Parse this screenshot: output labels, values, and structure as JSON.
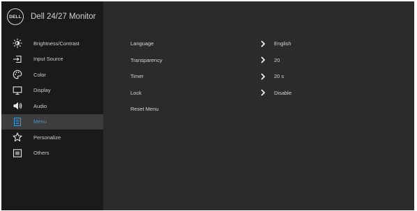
{
  "header": {
    "logo_text": "DELL",
    "model": "Dell 24/27 Monitor"
  },
  "sidebar": {
    "active_color": "#2f9de8",
    "items": [
      {
        "label": "Brightness/Contrast",
        "icon": "brightness-icon"
      },
      {
        "label": "Input Source",
        "icon": "input-source-icon"
      },
      {
        "label": "Color",
        "icon": "color-palette-icon"
      },
      {
        "label": "Display",
        "icon": "display-monitor-icon"
      },
      {
        "label": "Audio",
        "icon": "speaker-icon"
      },
      {
        "label": "Menu",
        "icon": "menu-icon",
        "selected": true
      },
      {
        "label": "Personalize",
        "icon": "star-icon"
      },
      {
        "label": "Others",
        "icon": "others-icon"
      }
    ]
  },
  "menu": {
    "rows": [
      {
        "label": "Language",
        "value": "English"
      },
      {
        "label": "Transparency",
        "value": "20"
      },
      {
        "label": "Timer",
        "value": "20 s"
      },
      {
        "label": "Lock",
        "value": "Disable"
      },
      {
        "label": "Reset Menu"
      }
    ]
  }
}
